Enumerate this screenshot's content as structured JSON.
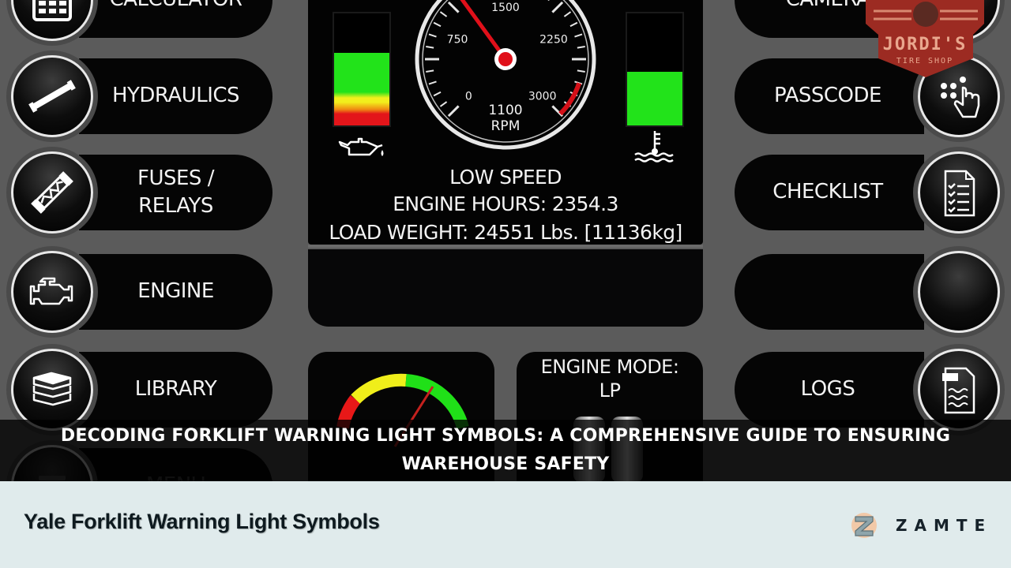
{
  "left_menu": [
    {
      "label": "CALCULATOR",
      "icon": "calculator-icon"
    },
    {
      "label": "HYDRAULICS",
      "icon": "hydraulic-cylinder-icon"
    },
    {
      "label": "FUSES /\nRELAYS",
      "label_line1": "FUSES /",
      "label_line2": "RELAYS",
      "icon": "fuse-icon"
    },
    {
      "label": "ENGINE",
      "icon": "engine-icon"
    },
    {
      "label": "LIBRARY",
      "icon": "books-icon"
    },
    {
      "label": "MENU",
      "icon": "menu-icon"
    }
  ],
  "right_menu": [
    {
      "label": "CAMERA",
      "icon": "camera-icon"
    },
    {
      "label": "PASSCODE",
      "icon": "keypad-touch-icon"
    },
    {
      "label": "CHECKLIST",
      "icon": "checklist-icon"
    },
    {
      "label": "",
      "icon": "blank-button"
    },
    {
      "label": "LOGS",
      "icon": "log-file-icon"
    }
  ],
  "gauge": {
    "tick_labels": [
      "0",
      "750",
      "1500",
      "2250",
      "3000"
    ],
    "rpm_value": "1100",
    "rpm_unit": "RPM",
    "min": 0,
    "max": 3000,
    "needle_value": 1100,
    "redline_start": 2700,
    "needle_color": "#e0101a"
  },
  "oil_pressure_bar": {
    "icon": "oil-can-icon",
    "level": 0.65
  },
  "coolant_temp_bar": {
    "icon": "coolant-temperature-icon",
    "level": 0.48
  },
  "status": {
    "speed_mode": "LOW SPEED",
    "engine_hours": "ENGINE HOURS: 2354.3",
    "load_weight": "LOAD WEIGHT:  24551 Lbs. [11136kg]"
  },
  "engine_mode": {
    "label": "ENGINE MODE:",
    "value": "LP",
    "icon": "lp-tanks-icon"
  },
  "voltage_gauge": {
    "icon": "voltage-gauge-icon"
  },
  "caption": "DECODING FORKLIFT WARNING LIGHT SYMBOLS: A COMPREHENSIVE GUIDE TO ENSURING WAREHOUSE SAFETY",
  "watermark": {
    "line1": "JORDI'S",
    "line2": "TIRE SHOP"
  },
  "footer": {
    "title": "Yale Forklift Warning Light Symbols",
    "brand": "ZAMTE"
  },
  "colors": {
    "background": "#5b5b5b",
    "panel": "#030303",
    "green": "#22e31a",
    "yellow": "#f2ef1c",
    "orange": "#f08a12",
    "red": "#e3151a",
    "footer_bg": "#e0ebec"
  }
}
